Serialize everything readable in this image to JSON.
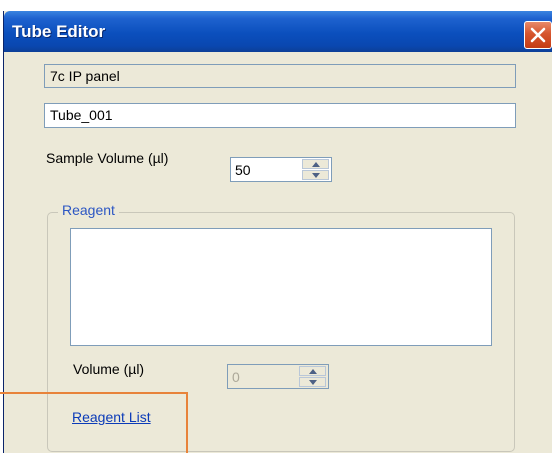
{
  "window": {
    "title": "Tube Editor"
  },
  "panel_name": "7c IP panel",
  "tube_name": "Tube_001",
  "sample_volume": {
    "label": "Sample Volume (µl)",
    "value": "50"
  },
  "reagent": {
    "group_title": "Reagent",
    "items": [],
    "volume_label": "Volume (µl)",
    "volume_value": "0",
    "link_label": "Reagent List"
  },
  "colors": {
    "titlebar": "#0a47b0",
    "window_bg": "#ece9d8",
    "link": "#0b3bb8",
    "group_title": "#2c56c3",
    "callout": "#e8833a"
  },
  "icons": {
    "close": "close-icon",
    "spin_up": "arrow-up-icon",
    "spin_down": "arrow-down-icon"
  }
}
